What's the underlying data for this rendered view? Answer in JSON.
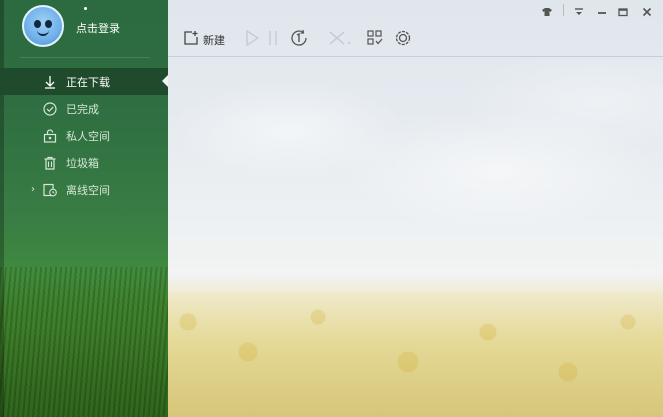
{
  "user": {
    "login_text": "点击登录"
  },
  "nav": {
    "items": [
      {
        "label": "正在下载",
        "icon": "download-icon",
        "active": true
      },
      {
        "label": "已完成",
        "icon": "check-circle-icon",
        "active": false
      },
      {
        "label": "私人空间",
        "icon": "private-lock-icon",
        "active": false
      },
      {
        "label": "垃圾箱",
        "icon": "trash-icon",
        "active": false
      },
      {
        "label": "离线空间",
        "icon": "offline-clock-icon",
        "active": false,
        "expandable": true
      }
    ]
  },
  "toolbar": {
    "new_label": "新建",
    "icons": [
      "new-task-icon",
      "play-icon",
      "pause-icon",
      "limit-speed-icon",
      "delete-icon",
      "grid-icon",
      "settings-icon"
    ]
  },
  "window": {
    "icons": [
      "skin-icon",
      "menu-icon",
      "minimize-icon",
      "maximize-icon",
      "close-icon"
    ]
  },
  "colors": {
    "sidebar": "#2f6f41",
    "active_item": "#1f4a2b",
    "text_light": "#d7e7d7"
  }
}
